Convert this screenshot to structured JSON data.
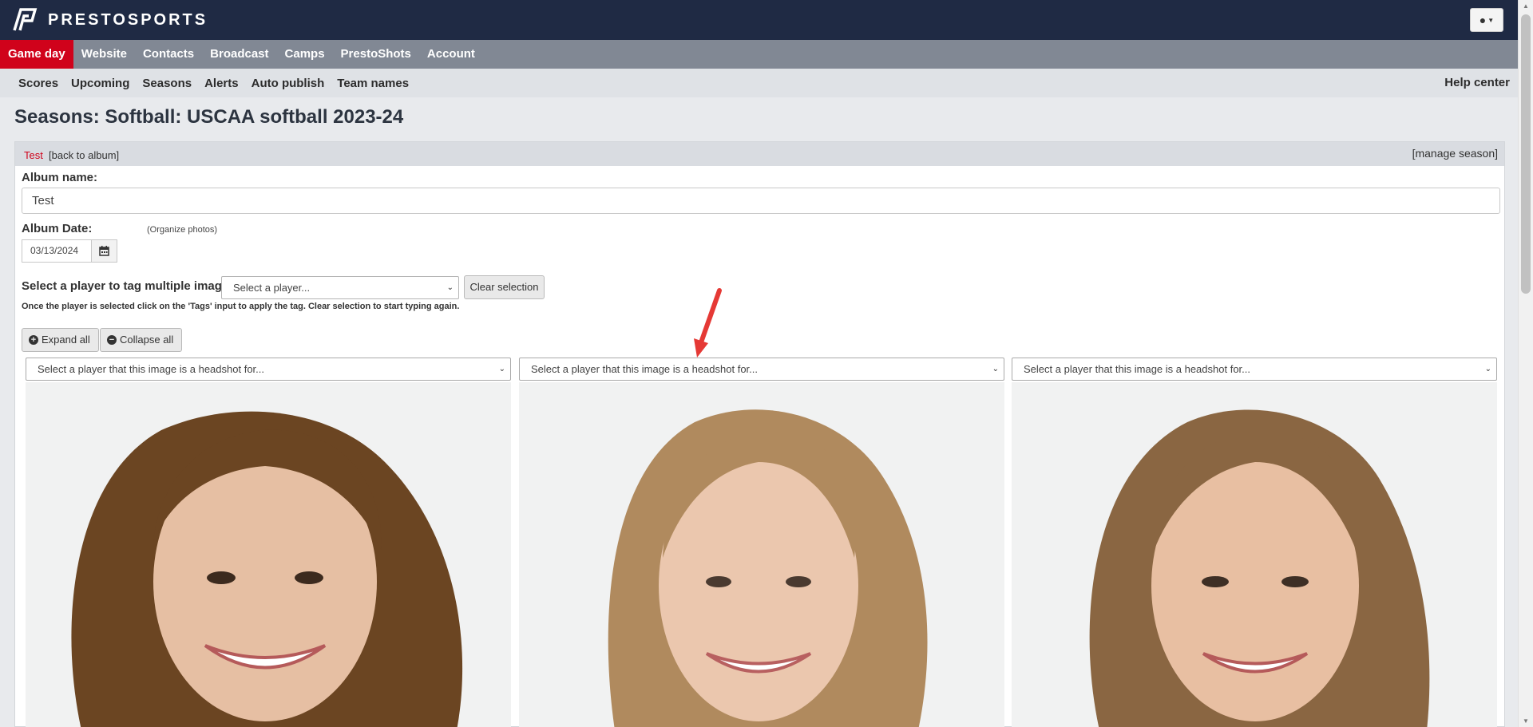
{
  "brand": {
    "name": "PRESTOSPORTS",
    "logo_icon": "prestosports-logo-icon"
  },
  "header": {
    "user_icon": "user-icon"
  },
  "main_nav": [
    {
      "label": "Game day",
      "active": true
    },
    {
      "label": "Website"
    },
    {
      "label": "Contacts"
    },
    {
      "label": "Broadcast"
    },
    {
      "label": "Camps"
    },
    {
      "label": "PrestoShots"
    },
    {
      "label": "Account"
    }
  ],
  "sub_nav": {
    "items": [
      "Scores",
      "Upcoming",
      "Seasons",
      "Alerts",
      "Auto publish",
      "Team names"
    ],
    "help": "Help center"
  },
  "page": {
    "title": "Seasons: Softball: USCAA softball 2023-24"
  },
  "panel": {
    "crumb_current": "Test",
    "crumb_back": "[back to album]",
    "manage": "[manage season]"
  },
  "form": {
    "album_name_label": "Album name:",
    "album_name_value": "Test",
    "album_date_label": "Album Date:",
    "organize_link": "(Organize photos)",
    "album_date_value": "03/13/2024",
    "tag_label": "Select a player to tag multiple images:",
    "tag_select_value": "Select a player...",
    "clear_button": "Clear selection",
    "hint": "Once the player is selected click on the 'Tags' input to apply the tag. Clear selection to start typing again."
  },
  "controls": {
    "expand_all": "Expand all",
    "collapse_all": "Collapse all"
  },
  "photos": [
    {
      "select_value": "Select a player that this image is a headshot for...",
      "hair_color": "#6b4522"
    },
    {
      "select_value": "Select a player that this image is a headshot for...",
      "hair_color": "#b08a5e"
    },
    {
      "select_value": "Select a player that this image is a headshot for...",
      "hair_color": "#8a6642"
    }
  ],
  "colors": {
    "topbar": "#1f2a44",
    "nav": "#818894",
    "active_nav": "#d0021b",
    "annotation_arrow": "#e53935"
  }
}
